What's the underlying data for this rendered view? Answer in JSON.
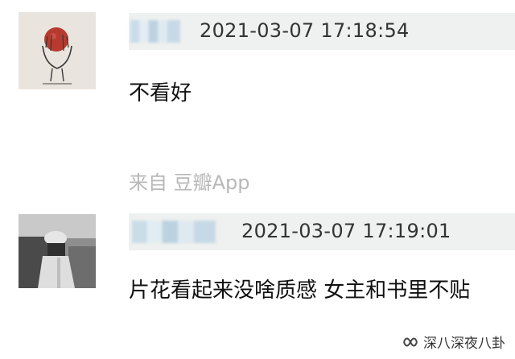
{
  "comments": [
    {
      "timestamp": "2021-03-07 17:18:54",
      "text": "不看好",
      "source": "来自 豆瓣App"
    },
    {
      "timestamp": "2021-03-07 17:19:01",
      "text": "片花看起来没啥质感 女主和书里不贴"
    }
  ],
  "watermark": {
    "label": "深八深夜八卦",
    "icon": "wechat-channel-icon"
  },
  "colors": {
    "header_bg": "#eef1ef",
    "timestamp": "#333333",
    "source_text": "#b8b8b8"
  }
}
